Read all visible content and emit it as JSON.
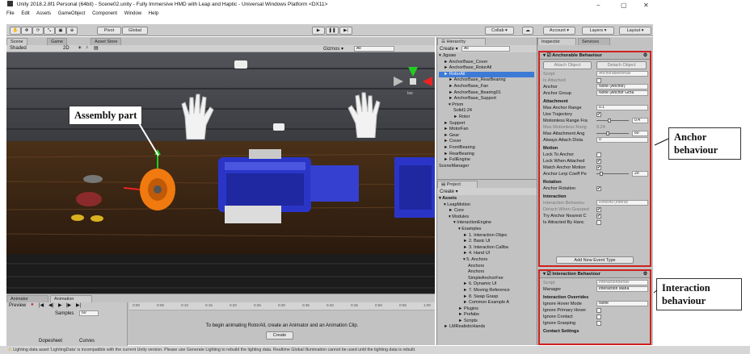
{
  "window": {
    "title": "Unity 2018.2.8f1 Personal (64bit) - Scene02.unity - Fully Immersive HMD with Leap and Haptic - Universal Windows Platform <DX11>",
    "minimize": "−",
    "maximize": "▢",
    "close": "✕"
  },
  "menu": [
    "File",
    "Edit",
    "Assets",
    "GameObject",
    "Component",
    "Window",
    "Help"
  ],
  "toolbar": {
    "pivot": "Pivot",
    "global": "Global",
    "collab": "Collab ▾",
    "account": "Account ▾",
    "layers": "Layers ▾",
    "layout": "Layout ▾"
  },
  "scene": {
    "tabs": [
      "Scene",
      "Game",
      "Asset Store"
    ],
    "shading": "Shaded",
    "mode2d": "2D",
    "gizmos": "Gizmos ▾",
    "search": "All",
    "iso": "Iso"
  },
  "annotation_assembly": "Assembly part",
  "hierarchy": {
    "title": "Hierarchy",
    "create": "Create ▾",
    "search": "All",
    "items": [
      {
        "label": "▾ Jigsaw",
        "indent": 0
      },
      {
        "label": "► AnchorBase_Cover",
        "indent": 1
      },
      {
        "label": "► AnchorBase_RotorAll",
        "indent": 1
      },
      {
        "label": "► RotorAll",
        "indent": 1,
        "selected": true
      },
      {
        "label": "► AnchorBase_RearBearing",
        "indent": 2
      },
      {
        "label": "► AnchorBase_Fan",
        "indent": 2
      },
      {
        "label": "► AnchorBase_Bearing01",
        "indent": 2
      },
      {
        "label": "► AnchorBase_Support",
        "indent": 2
      },
      {
        "label": "▾ Prism",
        "indent": 2
      },
      {
        "label": "Solid1:24",
        "indent": 3
      },
      {
        "label": "► Rotor",
        "indent": 3
      },
      {
        "label": "► Support",
        "indent": 1
      },
      {
        "label": "► MotorFan",
        "indent": 1
      },
      {
        "label": "► Gear",
        "indent": 1
      },
      {
        "label": "► Cover",
        "indent": 1
      },
      {
        "label": "► FrontBearing",
        "indent": 1
      },
      {
        "label": "► RearBearing",
        "indent": 1
      },
      {
        "label": "► FullEngine",
        "indent": 1
      },
      {
        "label": "SceneManager",
        "indent": 0
      }
    ]
  },
  "project": {
    "title": "Project",
    "create": "Create ▾",
    "items": [
      {
        "label": "▾ Assets",
        "indent": 0,
        "bold": true
      },
      {
        "label": "▾ LeapMotion",
        "indent": 1
      },
      {
        "label": "► Core",
        "indent": 2
      },
      {
        "label": "▾ Modules",
        "indent": 2
      },
      {
        "label": "▾ InteractionEngine",
        "indent": 3
      },
      {
        "label": "▾ Examples",
        "indent": 4
      },
      {
        "label": "► 1. Interaction Objec",
        "indent": 5
      },
      {
        "label": "► 2. Basic UI",
        "indent": 5
      },
      {
        "label": "► 3. Interaction Callba",
        "indent": 5
      },
      {
        "label": "► 4. Hand UI",
        "indent": 5
      },
      {
        "label": "▾ 5. Anchors",
        "indent": 5
      },
      {
        "label": "Anchors",
        "indent": 6
      },
      {
        "label": "Anchors",
        "indent": 6
      },
      {
        "label": "SimpleAnchorFee",
        "indent": 6
      },
      {
        "label": "► 6. Dynamic UI",
        "indent": 5
      },
      {
        "label": "► 7. Moving Reference",
        "indent": 5
      },
      {
        "label": "► 8. Swap Grasp",
        "indent": 5
      },
      {
        "label": "► Common Example A",
        "indent": 5
      },
      {
        "label": "► Plugins",
        "indent": 4
      },
      {
        "label": "► Prefabs",
        "indent": 4
      },
      {
        "label": "► Scripts",
        "indent": 4
      },
      {
        "label": "► LMRealisticHands",
        "indent": 1
      }
    ]
  },
  "inspector": {
    "tabs": [
      "Inspector",
      "Services"
    ],
    "anchorable": {
      "title": "Anchorable Behaviour",
      "attach": "Attach Object",
      "detach": "Detach Object",
      "rows": [
        {
          "label": "Script",
          "value": "AnchorableBehav",
          "kind": "field",
          "disabled": true
        },
        {
          "label": "Is Attached",
          "kind": "check",
          "checked": false,
          "disabled": true
        },
        {
          "label": "Anchor",
          "value": "None (Anchor)",
          "kind": "field"
        },
        {
          "label": "Anchor Group",
          "value": "None (Anchor Grou",
          "kind": "field"
        },
        {
          "label": "Attachment",
          "kind": "header"
        },
        {
          "label": "Max Anchor Range",
          "value": "0.1",
          "kind": "field"
        },
        {
          "label": "Use Trajectory",
          "kind": "check",
          "checked": true
        },
        {
          "label": "Motionless Range Fra",
          "value": "0.4",
          "kind": "slider",
          "fill": 0.4
        },
        {
          "label": "Max Motionless Rang",
          "value": "0.24",
          "kind": "text",
          "disabled": true
        },
        {
          "label": "Max Attachment Ang",
          "value": "60",
          "kind": "slider",
          "fill": 0.33
        },
        {
          "label": "Always Attach Dista",
          "value": "0",
          "kind": "field"
        },
        {
          "label": "Motion",
          "kind": "header"
        },
        {
          "label": "Lock To Anchor",
          "kind": "check",
          "checked": false
        },
        {
          "label": "Lock When Attached",
          "kind": "check",
          "checked": true
        },
        {
          "label": "Match Anchor Motion",
          "kind": "check",
          "checked": true
        },
        {
          "label": "Anchor Lerp Coeff Pe",
          "value": "20",
          "kind": "slider",
          "fill": 0.1
        },
        {
          "label": "Rotation",
          "kind": "header"
        },
        {
          "label": "Anchor Rotation",
          "kind": "check",
          "checked": true
        },
        {
          "label": "Interaction",
          "kind": "header"
        },
        {
          "label": "Interaction Behaviou",
          "value": "RotorAll (Interac",
          "kind": "field",
          "disabled": true
        },
        {
          "label": "Detach When Grasped",
          "kind": "check",
          "checked": true,
          "disabled": true
        },
        {
          "label": "Try Anchor Nearest C",
          "kind": "check",
          "checked": true
        },
        {
          "label": "Is Attracted By Hanc",
          "kind": "check",
          "checked": false
        }
      ],
      "add_event": "Add New Event Type"
    },
    "interaction": {
      "title": "Interaction Behaviour",
      "rows": [
        {
          "label": "Script",
          "value": "InteractionBehav",
          "kind": "field",
          "disabled": true
        },
        {
          "label": "Manager",
          "value": "Interaction Mana",
          "kind": "field"
        },
        {
          "label": "Interaction Overrides",
          "kind": "header"
        },
        {
          "label": "Ignore Hover Mode",
          "value": "None",
          "kind": "dropdown"
        },
        {
          "label": "Ignore Primary Hover",
          "kind": "check",
          "checked": false
        },
        {
          "label": "Ignore Contact",
          "kind": "check",
          "checked": false
        },
        {
          "label": "Ignore Grasping",
          "kind": "check",
          "checked": false
        },
        {
          "label": "Contact Settings",
          "kind": "header"
        }
      ]
    }
  },
  "animation": {
    "tabs": [
      "Animator",
      "Animation"
    ],
    "preview": "Preview",
    "samples_label": "Samples",
    "samples": "60",
    "times": [
      "0:00",
      "0:05",
      "0:10",
      "0:15",
      "0:20",
      "0:25",
      "0:30",
      "0:35",
      "0:40",
      "0:45",
      "0:50",
      "0:55",
      "1:00"
    ],
    "message": "To begin animating RotorAll, create an Animator and an Animation Clip.",
    "create": "Create",
    "dopesheet": "Dopesheet",
    "curves": "Curves"
  },
  "status": "Lighting data asset 'LightingData' is incompatible with the current Unity version. Please use Generate Lighting to rebuild the lighting data. Realtime Global Illumination cannot be used until the lighting data is rebuilt.",
  "labels": {
    "anchor": "Anchor behaviour",
    "interaction": "Interaction behaviour"
  },
  "colors": {
    "accent_red": "#d02020",
    "selection_blue": "#3d7ad6",
    "motor_blue": "#2a35c8",
    "orange_part": "#f07a10"
  }
}
